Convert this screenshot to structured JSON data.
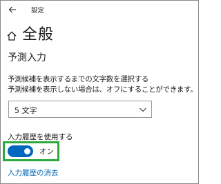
{
  "window": {
    "title": "設定",
    "back_icon": "back-arrow-icon"
  },
  "page": {
    "title": "全般",
    "icon": "home-icon"
  },
  "prediction": {
    "section_title": "予測入力",
    "description_line1": "予測候補を表示するまでの文字数を選択する",
    "description_line2": "予測候補を表示しない場合は、オフにすることができます。",
    "select_value": "5 文字",
    "chevron_icon": "chevron-down-icon"
  },
  "history": {
    "label": "入力履歴を使用する",
    "toggle_state": "オン",
    "toggle_on": true,
    "clear_link": "入力履歴の消去"
  },
  "colors": {
    "accent": "#0067c0",
    "link": "#0063b1",
    "highlight_border": "#2ca93a"
  }
}
